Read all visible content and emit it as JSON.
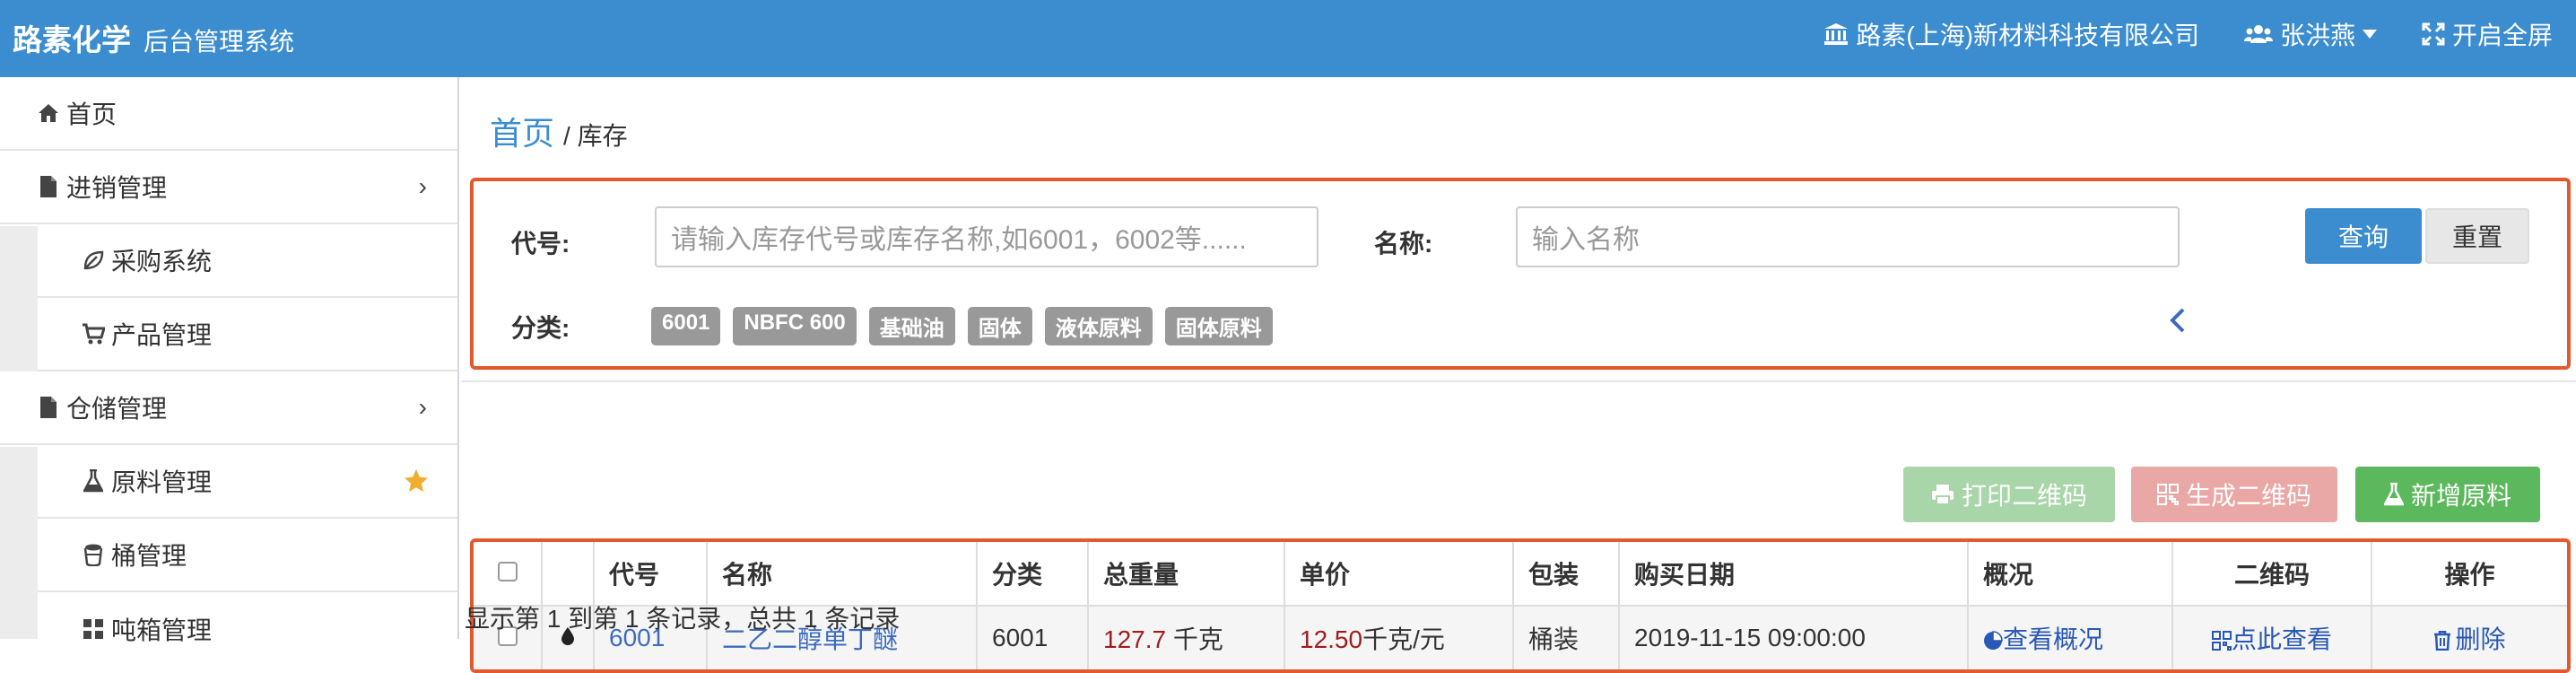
{
  "header": {
    "brand": "路素化学",
    "subtitle": "后台管理系统",
    "company": "路素(上海)新材料科技有限公司",
    "user": "张洪燕",
    "fullscreen": "开启全屏"
  },
  "sidebar": {
    "items": [
      {
        "label": "首页",
        "icon": "home-icon"
      },
      {
        "label": "进销管理",
        "icon": "file-icon"
      },
      {
        "label": "采购系统",
        "icon": "leaf-icon"
      },
      {
        "label": "产品管理",
        "icon": "cart-icon"
      },
      {
        "label": "仓储管理",
        "icon": "file-icon"
      },
      {
        "label": "原料管理",
        "icon": "flask-icon"
      },
      {
        "label": "桶管理",
        "icon": "bucket-icon"
      },
      {
        "label": "吨箱管理",
        "icon": "grid-icon"
      }
    ]
  },
  "breadcrumb": {
    "home": "首页",
    "current": "/ 库存"
  },
  "filter": {
    "code_label": "代号:",
    "code_placeholder": "请输入库存代号或库存名称,如6001，6002等......",
    "name_label": "名称:",
    "name_placeholder": "输入名称",
    "query": "查询",
    "reset": "重置",
    "category_label": "分类:",
    "tags": [
      "6001",
      "NBFC 600",
      "基础油",
      "固体",
      "液体原料",
      "固体原料"
    ]
  },
  "toolbar": {
    "print_qr": "打印二维码",
    "gen_qr": "生成二维码",
    "add_material": "新增原料"
  },
  "table": {
    "headers": [
      "代号",
      "名称",
      "分类",
      "总重量",
      "单价",
      "包装",
      "购买日期",
      "概况",
      "二维码",
      "操作"
    ],
    "rows": [
      {
        "code": "6001",
        "name": "二乙二醇单丁醚",
        "category": "6001",
        "weight_value": "127.7",
        "weight_unit": "千克",
        "price_value": "12.50",
        "price_unit": "千克/元",
        "package": "桶装",
        "date": "2019-11-15 09:00:00",
        "overview": "查看概况",
        "qr": "点此查看",
        "action": "删除"
      }
    ]
  },
  "footer": "显示第 1 到第 1 条记录，总共 1 条记录",
  "colors": {
    "primary": "#3c8dd0",
    "highlight": "#e2592f",
    "success": "#5cb85c",
    "danger_light": "#e9a7a5",
    "success_light": "#a9d6a9"
  }
}
